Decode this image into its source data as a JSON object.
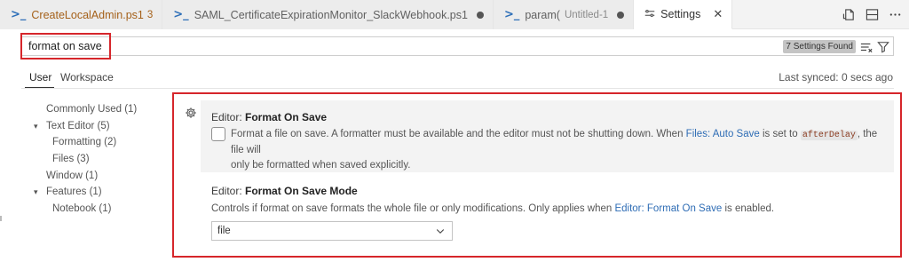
{
  "tabs": [
    {
      "title": "CreateLocalAdmin.ps1",
      "count": "3",
      "icon": "powershell-icon"
    },
    {
      "title": "SAML_CertificateExpirationMonitor_SlackWebhook.ps1",
      "icon": "powershell-icon"
    },
    {
      "title": "param(",
      "description": "Untitled-1",
      "icon": "powershell-icon"
    },
    {
      "title": "Settings",
      "icon": "settings-gear-icon",
      "close": "✕"
    }
  ],
  "search": {
    "value": "format on save",
    "found": "7 Settings Found"
  },
  "scope": {
    "user": "User",
    "workspace": "Workspace",
    "last_synced": "Last synced: 0 secs ago"
  },
  "toc": [
    {
      "label": "Commonly Used (1)"
    },
    {
      "label": "Text Editor (5)"
    },
    {
      "label": "Formatting (2)"
    },
    {
      "label": "Files (3)"
    },
    {
      "label": "Window (1)"
    },
    {
      "label": "Features (1)"
    },
    {
      "label": "Notebook (1)"
    }
  ],
  "settings": {
    "format_on_save": {
      "category": "Editor: ",
      "name": "Format On Save",
      "desc_part1": "Format a file on save. A formatter must be available and the editor must not be shutting down. When ",
      "link": "Files: Auto Save",
      "desc_part2": " is set to ",
      "code": "afterDelay",
      "desc_part3": ", the file will",
      "desc_line2": "only be formatted when saved explicitly.",
      "checked": false
    },
    "format_on_save_mode": {
      "category": "Editor: ",
      "name": "Format On Save Mode",
      "desc_part1": "Controls if format on save formats the whole file or only modifications. Only applies when ",
      "link": "Editor: Format On Save",
      "desc_part2": " is enabled.",
      "selected": "file"
    }
  },
  "colors": {
    "highlight_box": "#d6262b",
    "link": "#2f6db5",
    "powershell": "#2e6fb8"
  }
}
